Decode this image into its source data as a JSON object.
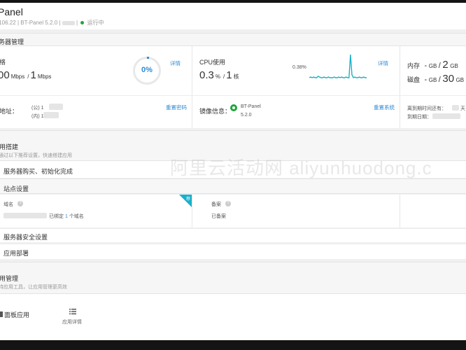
{
  "header": {
    "title": "Panel",
    "subtitle_ip": ".106.22",
    "subtitle_version": "BT-Panel 5.2.0",
    "status": "运行中"
  },
  "server_mgmt": {
    "section_title": "务器管理",
    "network": {
      "label": "络",
      "value_left": "00",
      "unit_left": "Mbps",
      "sep": "/",
      "value_right": "1",
      "unit_right": "Mbps",
      "gauge_percent": "0%",
      "gauge_fraction": 0,
      "details_link": "详情"
    },
    "cpu": {
      "label": "CPU使用",
      "value": "0.3",
      "unit": "%",
      "sep": "/",
      "cores": "1",
      "cores_unit": "核",
      "peak_label": "0.38%",
      "details_link": "详情"
    },
    "memory": {
      "label": "内存",
      "used": "-",
      "used_unit": "GB",
      "total": "2",
      "total_unit": "GB"
    },
    "disk": {
      "label": "磁盘",
      "used": "-",
      "used_unit": "GB",
      "total": "30",
      "total_unit": "GB"
    },
    "address": {
      "label": "地址：",
      "public": "(公) 1",
      "private": "(内) 1",
      "reset_link": "重置密码"
    },
    "image": {
      "label": "镜像信息：",
      "name": "BT-Panel",
      "version": "5.2.0",
      "reset_link": "重置系统"
    },
    "expiry": {
      "label": "离到期时间还有：",
      "days_unit": "天",
      "date_label": "到期日期："
    }
  },
  "quick_build": {
    "title": "用搭建",
    "desc": "通过以下推荐设置，快速搭建应用",
    "item": "服务器购买、初始化完成"
  },
  "site_settings": {
    "title": "站点设置",
    "domain": {
      "label": "域名",
      "text_prefix": "已绑定",
      "count": "1",
      "text_suffix": "个域名",
      "badge": "荐"
    },
    "icp": {
      "label": "备案",
      "status": "已备案"
    }
  },
  "security": {
    "title": "服务器安全设置"
  },
  "deploy": {
    "title": "应用部署"
  },
  "app_mgmt": {
    "title": "用管理",
    "desc": "持应用工具，让应用管理更高效",
    "items": [
      {
        "label": "面板应用",
        "icon": "app-icon"
      },
      {
        "label": "应用详情",
        "icon": "list-icon"
      }
    ]
  },
  "watermark": "阿里云活动网 aliyunhuodong.c",
  "colors": {
    "accent": "#20a53a",
    "blue": "#2e8bd6",
    "chart_line": "#1ab0c8",
    "badge": "#1ab0c8"
  },
  "cpu_series": [
    0.05,
    0.06,
    0.05,
    0.06,
    0.05,
    0.05,
    0.07,
    0.06,
    0.05,
    0.05,
    0.06,
    0.05,
    0.05,
    0.06,
    0.05,
    0.05,
    0.05,
    0.06,
    0.05,
    0.05,
    0.06,
    0.05,
    0.06,
    0.05,
    0.05,
    0.06,
    0.05,
    0.05,
    0.38,
    0.09,
    0.05,
    0.06,
    0.05,
    0.05,
    0.06,
    0.05,
    0.05,
    0.06,
    0.05,
    0.05
  ]
}
